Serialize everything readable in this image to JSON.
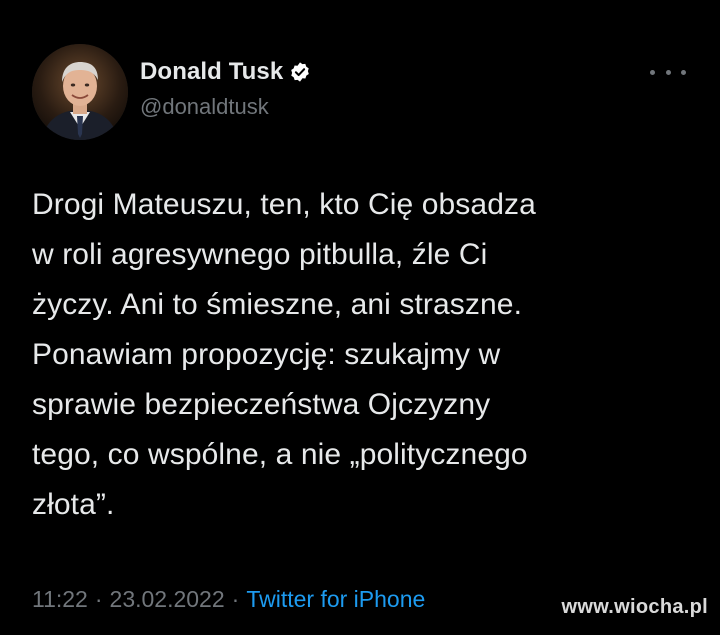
{
  "author": {
    "display_name": "Donald Tusk",
    "handle": "@donaldtusk",
    "verified": true
  },
  "tweet": {
    "text": "Drogi Mateuszu, ten, kto Cię obsadza\nw roli agresywnego pitbulla, źle Ci\nżyczy. Ani to śmieszne, ani straszne.\nPonawiam propozycję: szukajmy w\nsprawie bezpieczeństwa Ojczyzny\ntego, co wspólne, a nie „politycznego\nzłota”.",
    "time": "11:22",
    "separator": "·",
    "date": "23.02.2022",
    "source": "Twitter for iPhone"
  },
  "watermark": "www.wiocha.pl",
  "icons": {
    "verified": "verified-badge-icon",
    "more": "more-options-icon"
  },
  "colors": {
    "background": "#000000",
    "text": "#e7e9ea",
    "secondary": "#71767b",
    "link": "#1d9bf0"
  }
}
